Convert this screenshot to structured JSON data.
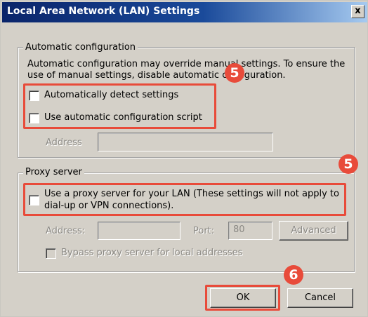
{
  "window": {
    "title": "Local Area Network (LAN) Settings",
    "close_label": "x"
  },
  "auto_config": {
    "legend": "Automatic configuration",
    "desc_line1": "Automatic configuration may override manual settings.  To ensure the",
    "desc_line2": "use of manual settings, disable automatic configuration.",
    "detect_label": "Automatically detect settings",
    "detect_checked": false,
    "script_label": "Use automatic configuration script",
    "script_checked": false,
    "address_label": "Address",
    "address_value": ""
  },
  "proxy": {
    "legend": "Proxy server",
    "use_proxy_line1": "Use a proxy server for your LAN (These settings will not apply to",
    "use_proxy_line2": "dial-up or VPN connections).",
    "use_proxy_checked": false,
    "address_label": "Address:",
    "address_value": "",
    "port_label": "Port:",
    "port_value": "80",
    "advanced_label": "Advanced",
    "bypass_label": "Bypass proxy server for local addresses",
    "bypass_checked": false
  },
  "buttons": {
    "ok": "OK",
    "cancel": "Cancel"
  },
  "annotations": {
    "step_auto": "5",
    "step_proxy": "5",
    "step_ok": "6",
    "accent_color": "#e84b3a"
  }
}
